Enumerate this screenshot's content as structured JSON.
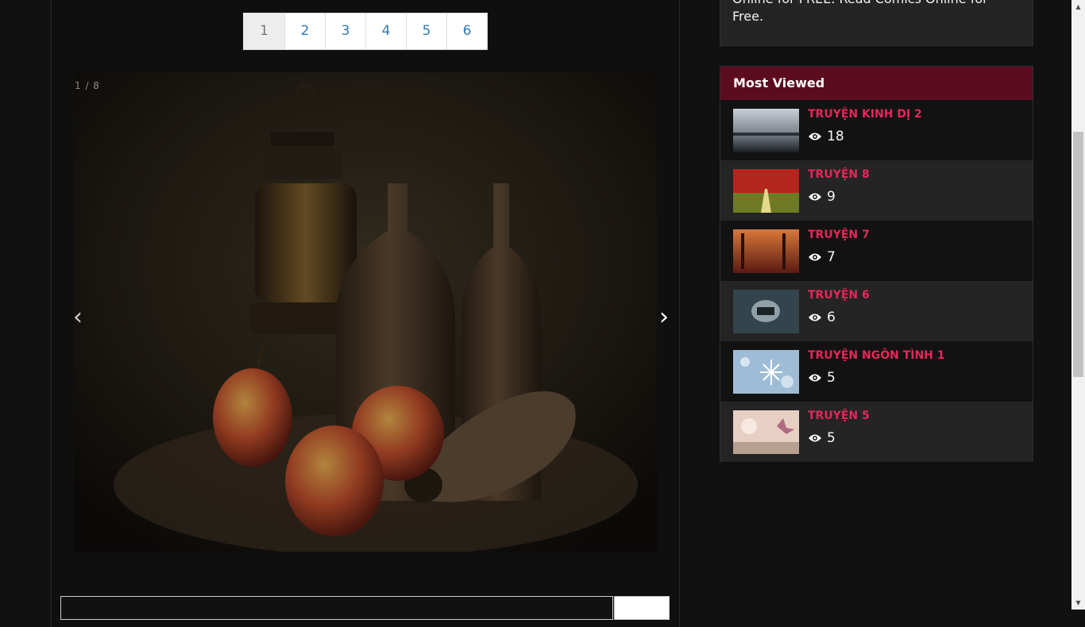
{
  "pagination": {
    "pages": [
      "1",
      "2",
      "3",
      "4",
      "5",
      "6"
    ],
    "active": "1"
  },
  "slider": {
    "counter": "1 / 8",
    "prev": "‹",
    "next": "›"
  },
  "sidebar": {
    "about_text": "Online for FREE. Read Comics Online for Free.",
    "most_viewed": {
      "title": "Most Viewed",
      "items": [
        {
          "title": "TRUYỆN KINH DỊ 2",
          "views": "18"
        },
        {
          "title": "TRUYỆN 8",
          "views": "9"
        },
        {
          "title": "TRUYỆN 7",
          "views": "7"
        },
        {
          "title": "TRUYỆN 6",
          "views": "6"
        },
        {
          "title": "TRUYỆN NGÔN TÌNH 1",
          "views": "5"
        },
        {
          "title": "TRUYỆN 5",
          "views": "5"
        }
      ]
    }
  },
  "colors": {
    "accent": "#e8265a",
    "header_bg": "#5c0c1f",
    "link": "#337ab7"
  },
  "icons": {
    "views": "eye-icon",
    "prev": "chevron-left-icon",
    "next": "chevron-right-icon"
  }
}
